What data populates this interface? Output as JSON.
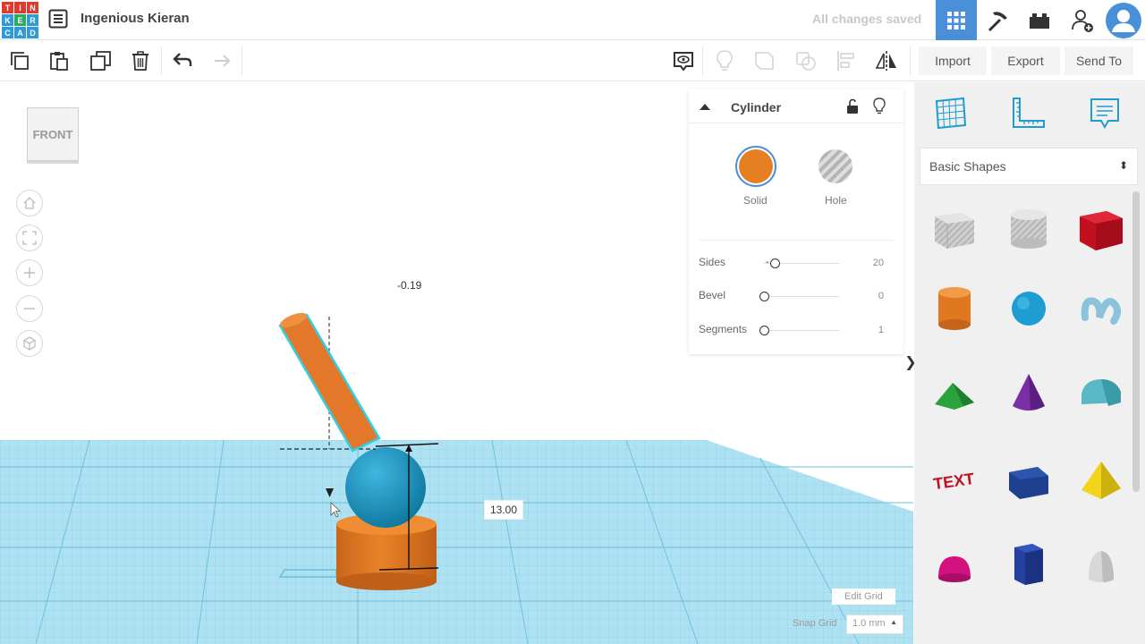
{
  "logo": {
    "letters": [
      "T",
      "I",
      "N",
      "K",
      "E",
      "R",
      "C",
      "A",
      "D"
    ]
  },
  "header": {
    "project_title": "Ingenious Kieran",
    "save_status": "All changes saved"
  },
  "toolbar": {
    "import_label": "Import",
    "export_label": "Export",
    "send_to_label": "Send To"
  },
  "viewport": {
    "view_cube_label": "FRONT",
    "rotation_readout": "-0.19",
    "height_readout": "13.00",
    "edit_grid_label": "Edit Grid",
    "snap_grid_label": "Snap Grid",
    "snap_grid_value": "1.0 mm"
  },
  "inspector": {
    "title": "Cylinder",
    "solid_label": "Solid",
    "hole_label": "Hole",
    "properties": [
      {
        "label": "Sides",
        "value": "20",
        "level": 0.13
      },
      {
        "label": "Bevel",
        "value": "0",
        "level": 0.0
      },
      {
        "label": "Segments",
        "value": "1",
        "level": 0.0
      }
    ]
  },
  "shapes_panel": {
    "library_selected": "Basic Shapes"
  },
  "colors": {
    "accent_blue": "#4a90d9",
    "orange": "#e67e22",
    "sphere_blue": "#1e9ccc",
    "grid_cyan": "#9fdcef"
  }
}
